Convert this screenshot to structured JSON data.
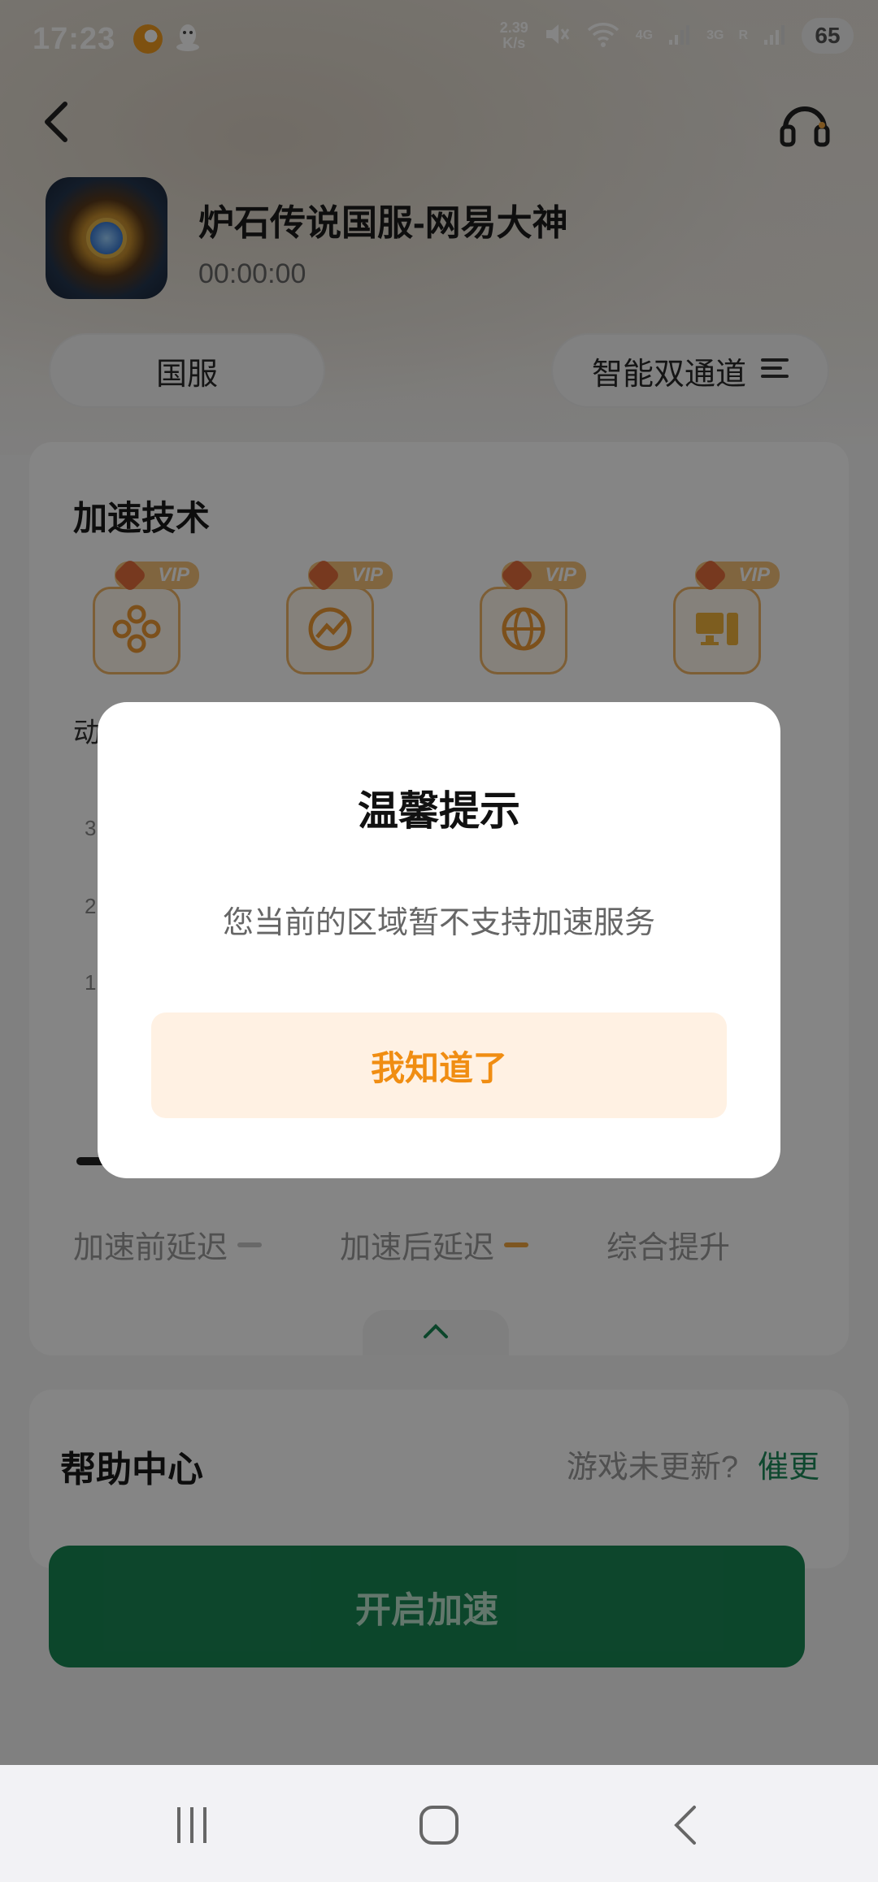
{
  "status_bar": {
    "time": "17:23",
    "net_speed_value": "2.39",
    "net_speed_unit": "K/s",
    "signal1_label": "4G",
    "signal2_label": "3G",
    "roaming_label": "R",
    "battery": "65"
  },
  "game": {
    "title": "炉石传说国服-网易大神",
    "elapsed": "00:00:00"
  },
  "options": {
    "server": "国服",
    "channel": "智能双通道"
  },
  "tech_card": {
    "title": "加速技术",
    "vip_label": "VIP",
    "features": [
      {
        "icon": "multi-link-icon"
      },
      {
        "icon": "boost-chart-icon"
      },
      {
        "icon": "globe-icon"
      },
      {
        "icon": "desktop-pc-icon"
      }
    ],
    "feature_label_partial": "动",
    "axis_ticks": [
      "3",
      "2",
      "1"
    ],
    "stats": {
      "before": "加速前延迟",
      "after": "加速后延迟",
      "improve": "综合提升"
    }
  },
  "help": {
    "title": "帮助中心",
    "question": "游戏未更新?",
    "link": "催更"
  },
  "start_button": "开启加速",
  "dialog": {
    "title": "温馨提示",
    "message": "您当前的区域暂不支持加速服务",
    "confirm": "我知道了"
  },
  "colors": {
    "primary_green": "#188754",
    "accent_orange": "#f08d12",
    "dialog_button_bg": "#fff1e3"
  }
}
